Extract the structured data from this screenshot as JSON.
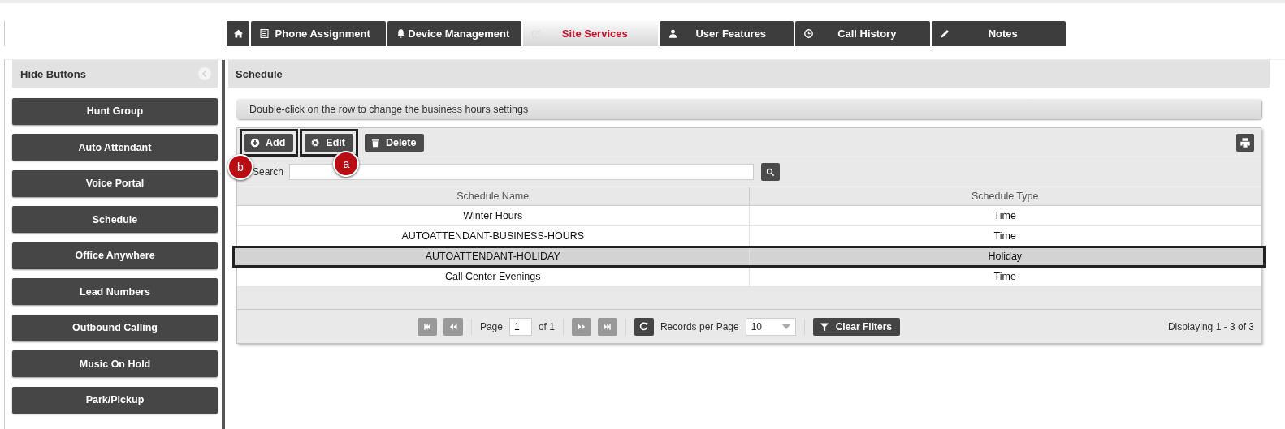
{
  "tabs": [
    {
      "selected": false
    },
    {
      "label": "Phone Assignment",
      "selected": false
    },
    {
      "label": "Device Management",
      "selected": false
    },
    {
      "label": "Site Services",
      "selected": true
    },
    {
      "label": "User Features",
      "selected": false
    },
    {
      "label": "Call History",
      "selected": false
    },
    {
      "label": "Notes",
      "selected": false
    }
  ],
  "sidebar": {
    "title": "Hide Buttons",
    "items": [
      "Hunt Group",
      "Auto Attendant",
      "Voice Portal",
      "Schedule",
      "Office Anywhere",
      "Lead Numbers",
      "Outbound Calling",
      "Music On Hold",
      "Park/Pickup"
    ]
  },
  "panel": {
    "title": "Schedule",
    "hint": "Double-click on the row to change the business hours settings",
    "toolbar": [
      {
        "label": "Add",
        "highlighted": true,
        "callout": "b"
      },
      {
        "label": "Edit",
        "highlighted": true,
        "callout": "a"
      },
      {
        "label": "Delete",
        "highlighted": false
      }
    ],
    "search_label": "Search",
    "table": {
      "columns": [
        "Schedule Name",
        "Schedule Type"
      ],
      "rows": [
        {
          "cells": [
            "Winter Hours",
            "Time"
          ],
          "selected": false
        },
        {
          "cells": [
            "AUTOATTENDANT-BUSINESS-HOURS",
            "Time"
          ],
          "selected": false
        },
        {
          "cells": [
            "AUTOATTENDANT-HOLIDAY",
            "Holiday"
          ],
          "selected": true
        },
        {
          "cells": [
            "Call Center Evenings",
            "Time"
          ],
          "selected": false
        }
      ]
    },
    "pager": {
      "page_label": "Page",
      "page": "1",
      "of": "of 1",
      "records_label": "Records per Page",
      "per_page": "10",
      "clear_filters": "Clear Filters",
      "status": "Displaying 1 - 3 of 3"
    }
  }
}
